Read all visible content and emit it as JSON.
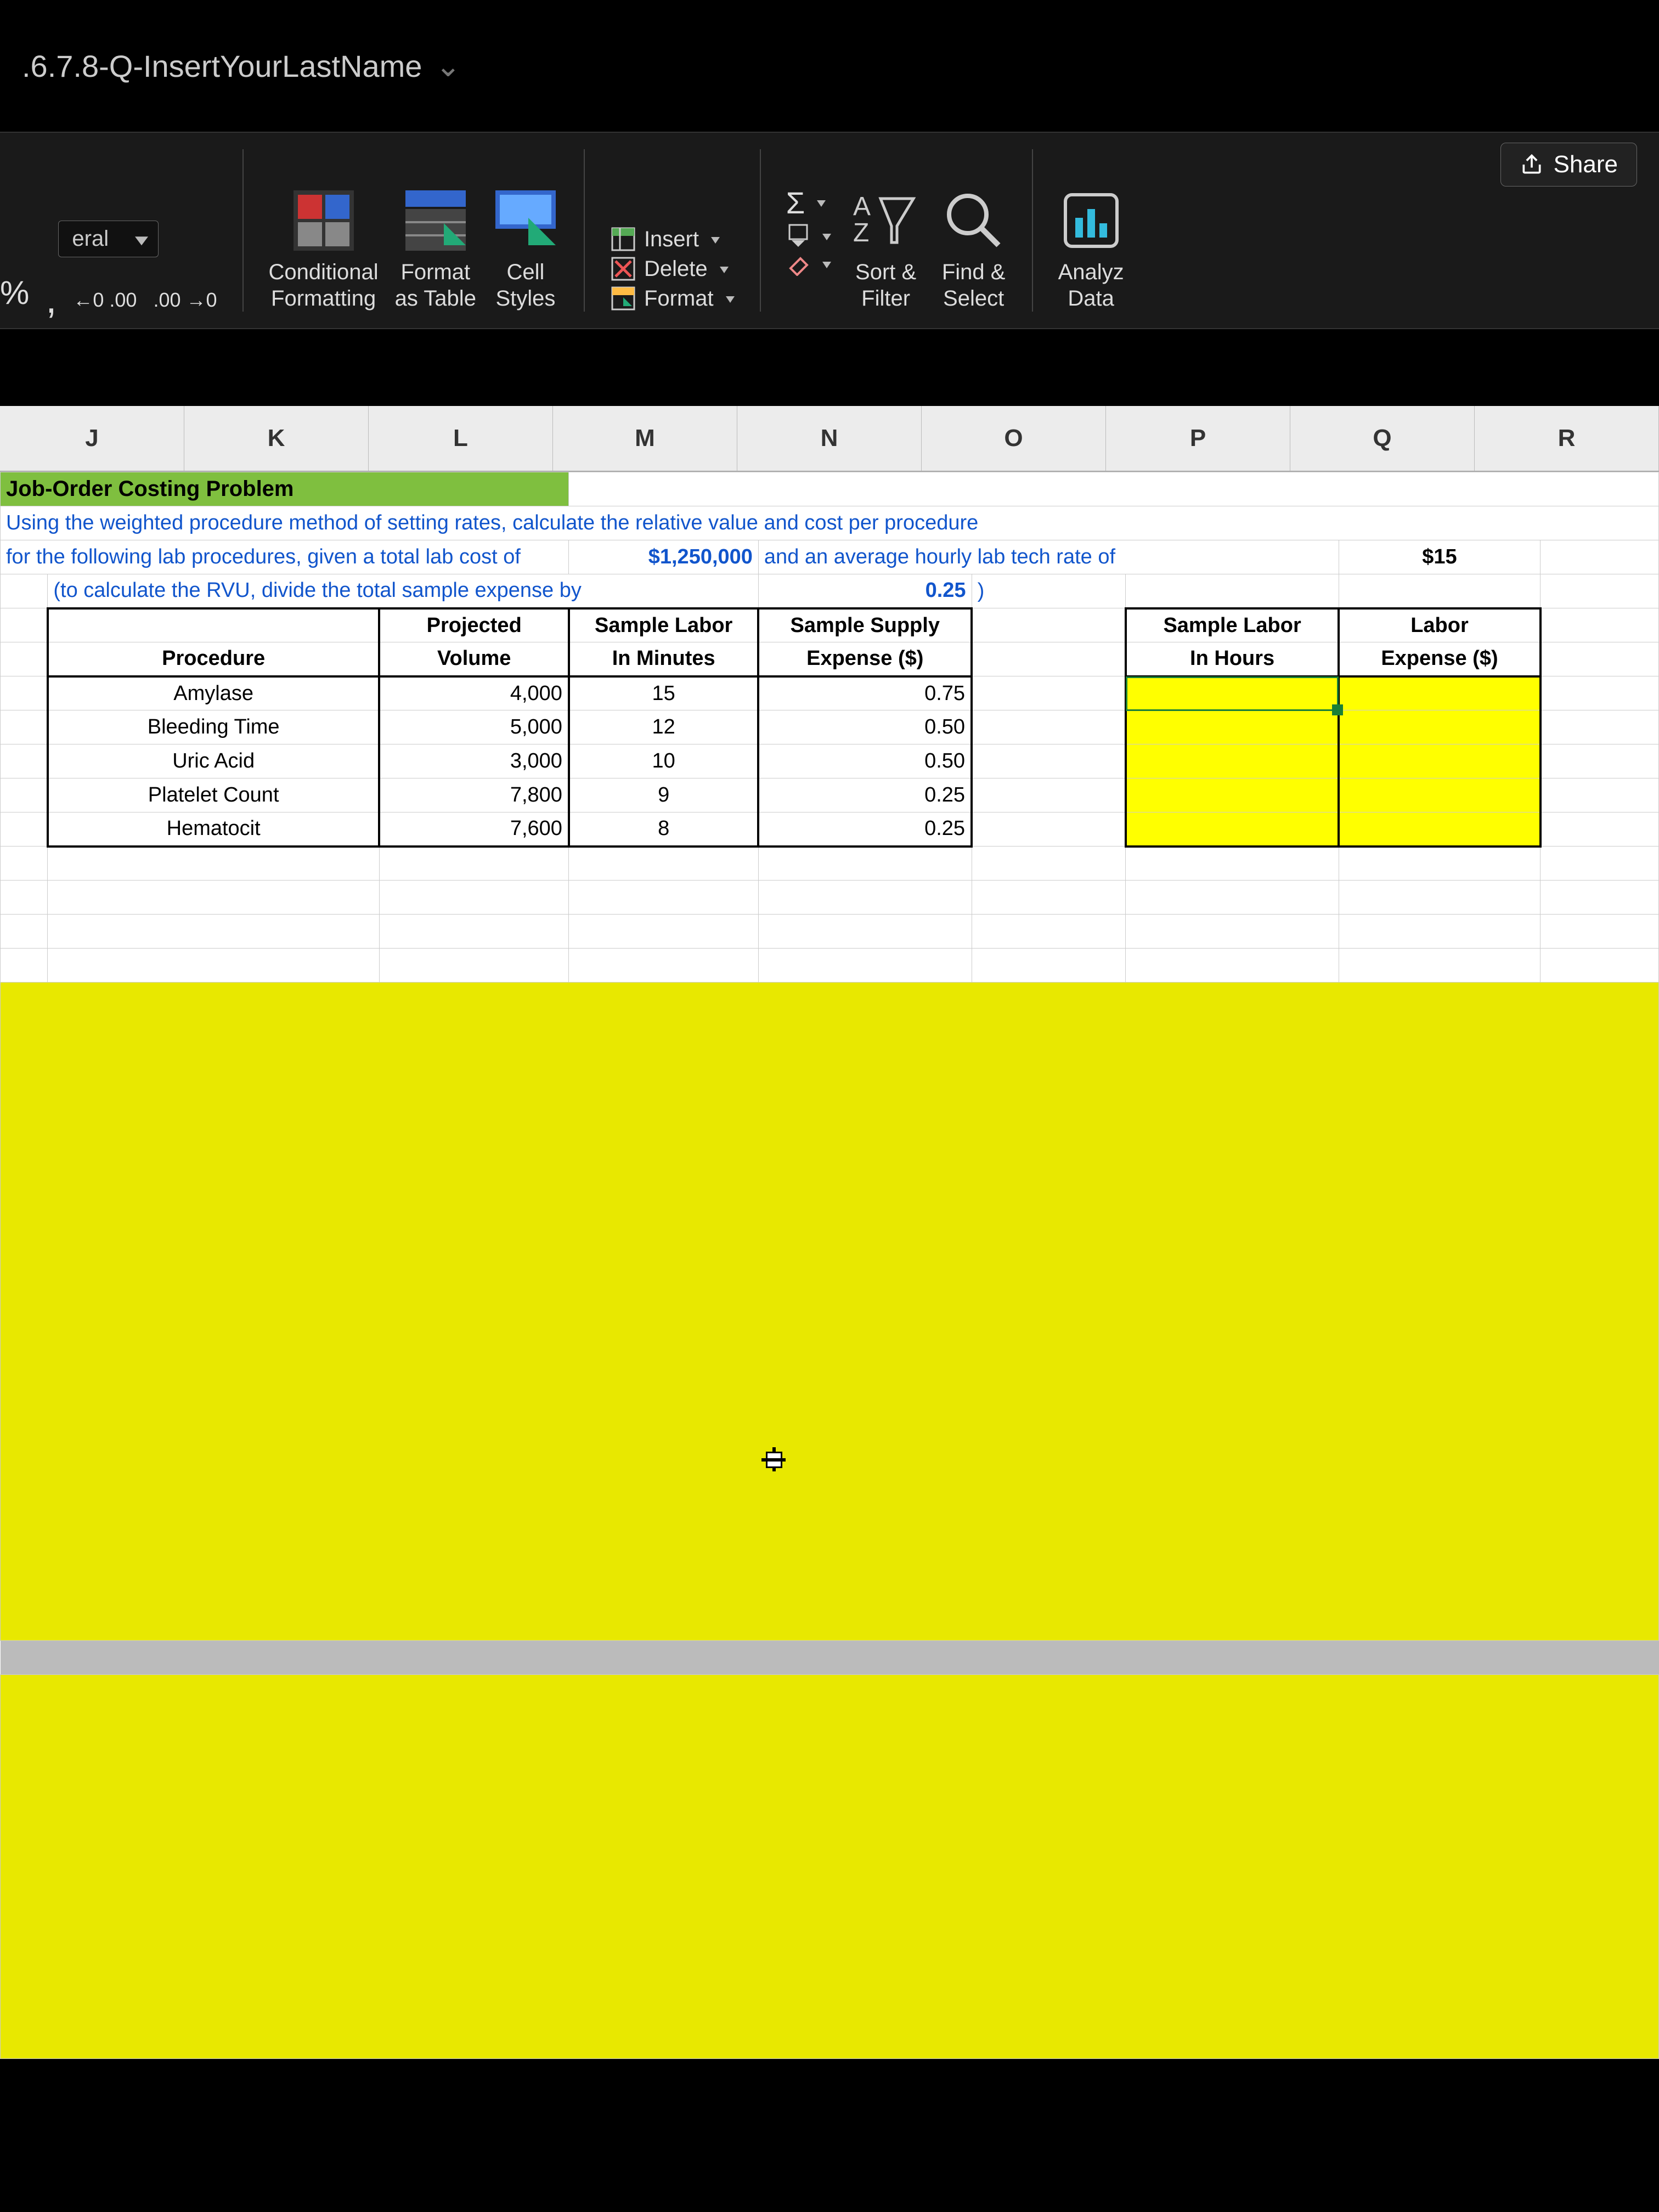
{
  "title": ".6.7.8-Q-InsertYourLastName",
  "share": "Share",
  "ribbon": {
    "numfmt": "eral",
    "percent": "%",
    "comma": ",",
    "dec_dec": "←0 .00",
    "inc_dec": ".00 →0",
    "cond_fmt_1": "Conditional",
    "cond_fmt_2": "Formatting",
    "fmt_tbl_1": "Format",
    "fmt_tbl_2": "as Table",
    "cell_sty_1": "Cell",
    "cell_sty_2": "Styles",
    "insert": "Insert",
    "delete": "Delete",
    "format": "Format",
    "sortfilter_1": "Sort &",
    "sortfilter_2": "Filter",
    "findsel_1": "Find &",
    "findsel_2": "Select",
    "analyze_1": "Analyz",
    "analyze_2": "Data"
  },
  "columns": [
    "J",
    "K",
    "L",
    "M",
    "N",
    "O",
    "P",
    "Q",
    "R"
  ],
  "problem": {
    "title": "Job-Order Costing Problem",
    "line1": "Using the weighted procedure method of setting rates, calculate the relative value and cost per procedure",
    "line2a": "for the following lab procedures, given a total lab cost of",
    "total_cost": "$1,250,000",
    "line2b": "and an average hourly lab tech rate of",
    "rate": "$15",
    "line3a": "(to calculate the RVU, divide the total sample expense by",
    "divisor": "0.25",
    "line3b": ")"
  },
  "table": {
    "hdr_proc": "Procedure",
    "hdr_proj1": "Projected",
    "hdr_proj2": "Volume",
    "hdr_labmin1": "Sample Labor",
    "hdr_labmin2": "In Minutes",
    "hdr_supply1": "Sample Supply",
    "hdr_supply2": "Expense ($)",
    "hdr_labhrs1": "Sample Labor",
    "hdr_labhrs2": "In Hours",
    "hdr_labexp1": "Labor",
    "hdr_labexp2": "Expense ($)",
    "rows": [
      {
        "proc": "Amylase",
        "vol": "4,000",
        "min": "15",
        "sup": "0.75"
      },
      {
        "proc": "Bleeding Time",
        "vol": "5,000",
        "min": "12",
        "sup": "0.50"
      },
      {
        "proc": "Uric Acid",
        "vol": "3,000",
        "min": "10",
        "sup": "0.50"
      },
      {
        "proc": "Platelet Count",
        "vol": "7,800",
        "min": "9",
        "sup": "0.25"
      },
      {
        "proc": "Hematocit",
        "vol": "7,600",
        "min": "8",
        "sup": "0.25"
      }
    ]
  }
}
